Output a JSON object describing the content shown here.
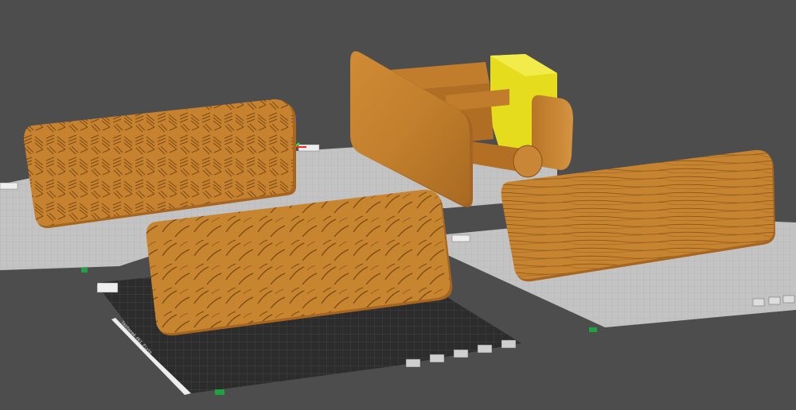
{
  "viewport": {
    "name": "3D slicer build plate view",
    "background_color": "#4d4d4e"
  },
  "plates": [
    {
      "id": "plate-1",
      "state": "inactive",
      "color": "#c7c7c7"
    },
    {
      "id": "plate-2",
      "state": "inactive",
      "color": "#c7c7c7"
    },
    {
      "id": "plate-3",
      "state": "active",
      "color": "#2a2a2a",
      "label": "Textured PEI Plate"
    },
    {
      "id": "plate-4",
      "state": "inactive",
      "color": "#c7c7c7"
    }
  ],
  "models": [
    {
      "id": "geometric-panel",
      "texture": "geometric woven pattern",
      "color": "#c8852d"
    },
    {
      "id": "leaf-panel",
      "texture": "leaf pattern",
      "color": "#c8852d"
    },
    {
      "id": "wood-grain-panel",
      "texture": "wood grain",
      "color": "#c8852d"
    },
    {
      "id": "holder-assembly",
      "texture": "smooth",
      "color": "#c8852d",
      "highlight_part_color": "#e6e020"
    }
  ],
  "plate_toolbar_icons": [
    "lock-icon",
    "layout-icon",
    "settings-icon",
    "orient-icon",
    "close-icon"
  ],
  "axis_colors": {
    "x": "#ff2020",
    "y": "#20ff20",
    "z": "#2030ff"
  },
  "plate_3_label": "Textured PEI Plate"
}
